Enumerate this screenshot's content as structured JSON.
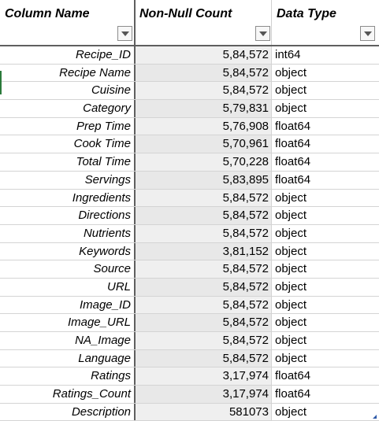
{
  "table": {
    "headers": {
      "column_name": "Column Name",
      "non_null_count": "Non-Null Count",
      "data_type": "Data Type"
    },
    "rows": [
      {
        "name": "Recipe_ID",
        "count": "5,84,572",
        "dtype": "int64"
      },
      {
        "name": "Recipe Name",
        "count": "5,84,572",
        "dtype": "object"
      },
      {
        "name": "Cuisine",
        "count": "5,84,572",
        "dtype": "object"
      },
      {
        "name": "Category",
        "count": "5,79,831",
        "dtype": "object"
      },
      {
        "name": "Prep Time",
        "count": "5,76,908",
        "dtype": "float64"
      },
      {
        "name": "Cook Time",
        "count": "5,70,961",
        "dtype": "float64"
      },
      {
        "name": "Total Time",
        "count": "5,70,228",
        "dtype": "float64"
      },
      {
        "name": "Servings",
        "count": "5,83,895",
        "dtype": "float64"
      },
      {
        "name": "Ingredients",
        "count": "5,84,572",
        "dtype": "object"
      },
      {
        "name": "Directions",
        "count": "5,84,572",
        "dtype": "object"
      },
      {
        "name": "Nutrients",
        "count": "5,84,572",
        "dtype": "object"
      },
      {
        "name": "Keywords",
        "count": "3,81,152",
        "dtype": "object"
      },
      {
        "name": "Source",
        "count": "5,84,572",
        "dtype": "object"
      },
      {
        "name": "URL",
        "count": "5,84,572",
        "dtype": "object"
      },
      {
        "name": "Image_ID",
        "count": "5,84,572",
        "dtype": "object"
      },
      {
        "name": "Image_URL",
        "count": "5,84,572",
        "dtype": "object"
      },
      {
        "name": "NA_Image",
        "count": "5,84,572",
        "dtype": "object"
      },
      {
        "name": "Language",
        "count": "5,84,572",
        "dtype": "object"
      },
      {
        "name": "Ratings",
        "count": "3,17,974",
        "dtype": "float64"
      },
      {
        "name": "Ratings_Count",
        "count": "3,17,974",
        "dtype": "float64"
      },
      {
        "name": "Description",
        "count": "581073",
        "dtype": "object"
      }
    ]
  },
  "icons": {
    "filter": "dropdown-arrow-icon"
  }
}
